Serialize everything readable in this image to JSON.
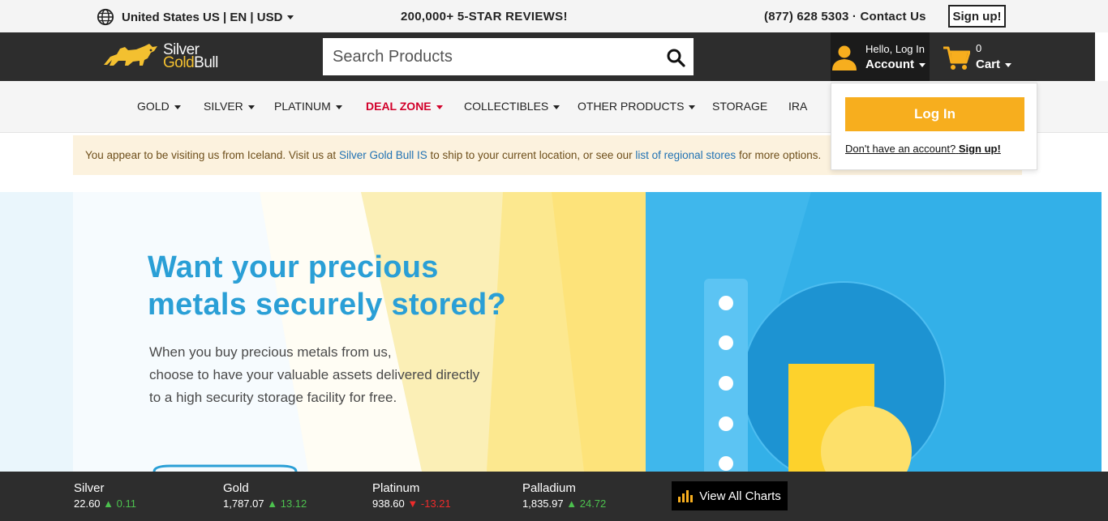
{
  "topbar": {
    "locale": "United States US | EN | USD",
    "reviews": "200,000+ 5-STAR REVIEWS!",
    "phone": "(877) 628 5303 · Contact Us",
    "signup": "Sign up!"
  },
  "header": {
    "logo_line1": "Silver",
    "logo_gold": "Gold",
    "logo_bull": "Bull",
    "search_placeholder": "Search Products",
    "account_hello": "Hello, Log In",
    "account_label": "Account",
    "cart_count": "0",
    "cart_label": "Cart"
  },
  "nav": {
    "items": [
      {
        "label": "GOLD"
      },
      {
        "label": "SILVER"
      },
      {
        "label": "PLATINUM"
      },
      {
        "label": "DEAL ZONE"
      },
      {
        "label": "COLLECTIBLES"
      },
      {
        "label": "OTHER PRODUCTS"
      },
      {
        "label": "STORAGE"
      },
      {
        "label": "IRA"
      }
    ]
  },
  "notice": {
    "text1": "You appear to be visiting us from Iceland. Visit us at ",
    "link1": "Silver Gold Bull IS",
    "text2": " to ship to your current location, or see our ",
    "link2": "list of regional stores",
    "text3": " for more options."
  },
  "dropdown": {
    "login": "Log In",
    "no_account": "Don't have an account?",
    "signup": "Sign up!"
  },
  "hero": {
    "title_line1": "Want your precious",
    "title_line2": "metals securely stored?",
    "text_line1": "When you buy precious metals from us,",
    "text_line2": "choose to have your valuable assets delivered directly",
    "text_line3": "to a high security storage facility for free."
  },
  "ticker": {
    "items": [
      {
        "name": "Silver",
        "price": "22.60",
        "change": "0.11",
        "direction": "up"
      },
      {
        "name": "Gold",
        "price": "1,787.07",
        "change": "13.12",
        "direction": "up"
      },
      {
        "name": "Platinum",
        "price": "938.60",
        "change": "-13.21",
        "direction": "down"
      },
      {
        "name": "Palladium",
        "price": "1,835.97",
        "change": "24.72",
        "direction": "up"
      }
    ],
    "charts_button": "View All Charts"
  },
  "colors": {
    "brand_gold": "#f7ae1e",
    "header_dark": "#2d2d2d",
    "deal_red": "#d2002a",
    "hero_blue": "#2a9fd6",
    "up_green": "#4cc14e",
    "down_red": "#ef2b2b"
  }
}
